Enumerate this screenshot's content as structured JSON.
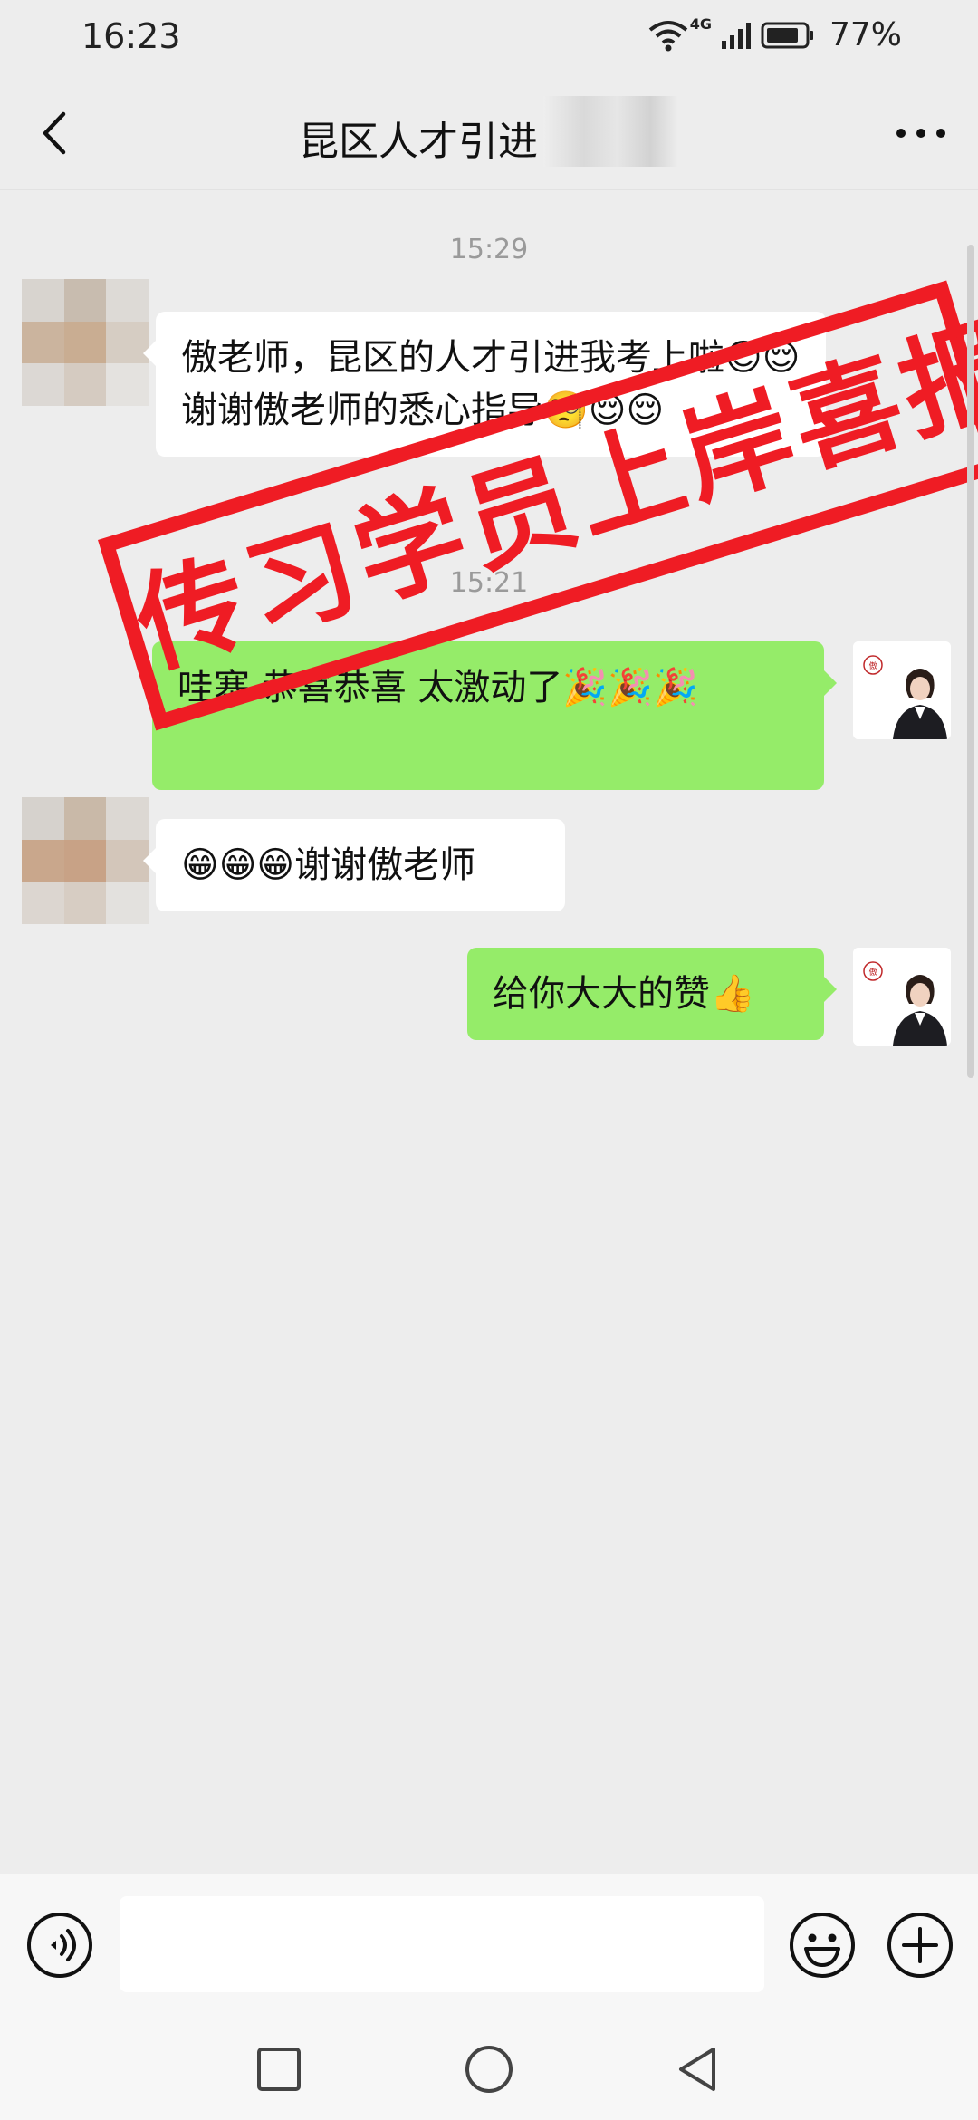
{
  "status_bar": {
    "time": "16:23",
    "network": "4G",
    "battery": "77%"
  },
  "chat": {
    "title": "昆区人才引进"
  },
  "messages": [
    {
      "type": "timestamp",
      "text": "15:29"
    },
    {
      "type": "in",
      "text": "傲老师，昆区的人才引进我考上啦😌😌谢谢傲老师的悉心指导🧐😌😌"
    },
    {
      "type": "timestamp",
      "text": "15:21"
    },
    {
      "type": "out",
      "text": "哇塞 恭喜恭喜 太激动了🎉🎉🎉"
    },
    {
      "type": "in",
      "text": "😁😁😁谢谢傲老师"
    },
    {
      "type": "out",
      "text": "给你大大的赞👍"
    }
  ],
  "avatar_self": {
    "seal_text": "傲老师"
  },
  "stamp": {
    "text": "传习学员上岸喜报",
    "color": "#ef1c24"
  },
  "colors": {
    "out_bubble": "#95ec69",
    "in_bubble": "#ffffff",
    "background": "#ededed"
  },
  "icons": {
    "back": "chevron-left-icon",
    "more": "more-dots-icon",
    "voice": "voice-icon",
    "emoji": "emoji-icon",
    "plus": "plus-icon",
    "recents": "square-icon",
    "home": "circle-icon",
    "back_sys": "triangle-back-icon"
  }
}
